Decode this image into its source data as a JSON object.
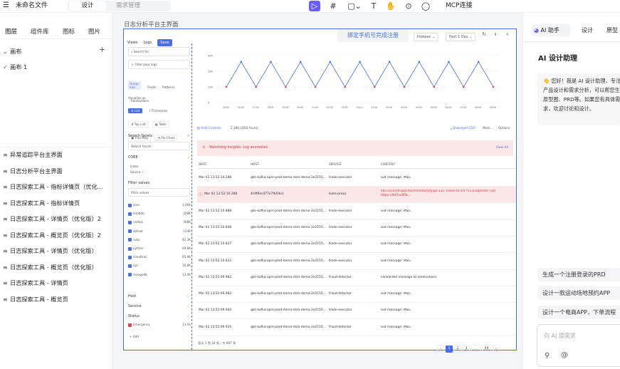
{
  "topbar": {
    "menu_icon": "menu-icon",
    "file_name": "未命名文件",
    "tab_design": "设计",
    "tab_requirements": "需求管理",
    "mcp": "MCP连接"
  },
  "left": {
    "tabs": [
      "图层",
      "组件库",
      "图标",
      "图片"
    ],
    "canvas_label": "画布",
    "canvas_item": "画布 1",
    "pages": [
      "异常追踪平台主界面",
      "日志分析平台主界面",
      "日志探索工具 - 指标详情页（优化...",
      "日志探索工具 - 指标详情页",
      "日志探索工具 - 详情页（优化版）2",
      "日志探索工具 - 概览页（优化版）2",
      "日志探索工具 - 详情页（优化版）",
      "日志探索工具 - 概览页（优化版）",
      "日志探索工具 - 详情页",
      "日志探索工具 - 概览页"
    ]
  },
  "canvas": {
    "frame_title": "日志分析平台主界面",
    "toast": "绑定手机号完成注册"
  },
  "app": {
    "views": "Views",
    "logs": "Logs",
    "save": "Save",
    "indexes": "Indexes",
    "past": "Past 1 Day",
    "search_for": "Search for",
    "filter_logs": "Filter your logs",
    "group_tabs": [
      "Group Into",
      "Fields",
      "Patterns",
      "Transactions"
    ],
    "visualize_as": "Visualize as",
    "viz": [
      "List",
      "Timeseries",
      "Top List",
      "Table",
      "Tree Map",
      "Pie Chart"
    ],
    "search_facets": "Search facets",
    "search_facets_ph": "Search facets",
    "core": "CORE",
    "index": "Index",
    "source": "Source",
    "filter_values": "Filter values",
    "filter_values_ph": "Filter values",
    "facets": [
      {
        "name": "java",
        "count": "1.06K"
      },
      {
        "name": "lambda",
        "count": "358K"
      },
      {
        "name": "nodejs",
        "count": "308K"
      },
      {
        "name": "dotnet",
        "count": "124K"
      },
      {
        "name": "ruby",
        "count": "92.3K"
      },
      {
        "name": "python",
        "count": "69.8K"
      },
      {
        "name": "cloudtrail",
        "count": "65.9K"
      },
      {
        "name": "vpc",
        "count": "16.8K"
      },
      {
        "name": "mongodb",
        "count": "13.0K"
      }
    ],
    "host": "Host",
    "service": "Service",
    "status": "Status",
    "emergency": "Emergency",
    "emergency_count": "13.0k",
    "add": "Add",
    "hide_controls": "Hide Controls",
    "logs_found": "2,386 LOGS found",
    "download": "Download CSV",
    "more": "More...",
    "options": "Options",
    "watchdog": "Watchdog Insights: Log anomalies",
    "view_all": "View All",
    "columns": [
      "DATE",
      "HOST",
      "SERVICE",
      "CONTENT"
    ],
    "rows": [
      {
        "date": "Mar 02 13:52:10.288",
        "host": "gke-kafka-apm-prod-demo-dsm-demo-2e2155...",
        "service": "trade-executor",
        "content": "Got message: MSG",
        "err": false
      },
      {
        "date": "Mar 02 13:52:10.288",
        "host": "4c9f9ec477e7fb59e1",
        "service": "kube-proxy",
        "content": "k8s.io/client-go/informers/factory.go:132: Failed to list *v1.Endpoints: Get https://947ee95b...",
        "err": true
      },
      {
        "date": "Mar 02 13:52:10.888",
        "host": "gke-kafka-apm-prod-demo-dsm-demo-2e2155...",
        "service": "trade-executor",
        "content": "Got message: MSG",
        "err": false
      },
      {
        "date": "Mar 02 13:52:10.848",
        "host": "gke-kafka-apm-prod-demo-dsm-demo-2e2155...",
        "service": "trade-executor",
        "content": "Got message: MSG",
        "err": false
      },
      {
        "date": "Mar 02 13:52:10.827",
        "host": "gke-kafka-apm-prod-demo-dsm-demo-2e2155...",
        "service": "trade-executor",
        "content": "Got message: MSG",
        "err": false
      },
      {
        "date": "Mar 02 13:52:10.822",
        "host": "gke-kafka-apm-prod-demo-dsm-demo-2e2155...",
        "service": "trade-executor",
        "content": "Got message: MSG",
        "err": false
      },
      {
        "date": "Mar 02 13:52:09.982",
        "host": "gke-kafka-apm-prod-demo-dsm-demo-2e2155...",
        "service": "fraud-detector",
        "content": "Forwarded message to notifications",
        "err": false
      },
      {
        "date": "Mar 02 13:52:09.982",
        "host": "gke-kafka-apm-prod-demo-dsm-demo-2e2155...",
        "service": "fraud-detector",
        "content": "Got message: MSG",
        "err": false
      },
      {
        "date": "Mar 02 13:52:09.944",
        "host": "gke-kafka-apm-prod-demo-dsm-demo-2e2155...",
        "service": "trade-executor",
        "content": "Got message: MSG",
        "err": false
      },
      {
        "date": "Mar 02 13:52:09.925",
        "host": "gke-kafka-apm-prod-demo-dsm-demo-2e2155...",
        "service": "fraud-detector",
        "content": "Got message: MSG",
        "err": false
      }
    ],
    "pager_info": "显示 1 到 10 条，共 687 条",
    "pages": [
      "‹",
      "1",
      "2",
      "3",
      "...",
      "69",
      "›"
    ]
  },
  "chart_data": {
    "type": "line",
    "yticks": [
      "30K",
      "20K",
      "10K",
      "0"
    ],
    "ylim": [
      0,
      30
    ],
    "categories": [
      "15:00",
      "16:00",
      "17:00",
      "18:00",
      "19:00",
      "20:00",
      "21:00",
      "22:00",
      "23:00",
      "Thu 2",
      "01:00",
      "02:00",
      "03:00",
      "04:00",
      "05:00",
      "06:00",
      "07:00",
      "08:00",
      "09:00"
    ],
    "values": [
      10,
      26,
      10,
      26,
      10,
      26,
      10,
      26,
      10,
      26,
      10,
      26,
      10,
      26,
      10,
      26,
      10,
      26,
      10
    ]
  },
  "right": {
    "ai_tab": "AI 助手",
    "design_tab": "设计",
    "proto_tab": "原型",
    "title": "AI 设计助理",
    "greeting": "👋 您好！我是 AI 设计助理，专注于产品设计和需求分析，可以帮您生成原型图、PRD等。如果您有具体需求，欢迎讨论和设计。",
    "suggestions": [
      "生成一个注册登录的PRD",
      "设计一款运动场地预约APP",
      "设计一个电商APP，下单流程"
    ],
    "input_ph": "向 AI 提需求",
    "attach_icon": "paperclip-icon",
    "at_icon": "at-icon"
  }
}
